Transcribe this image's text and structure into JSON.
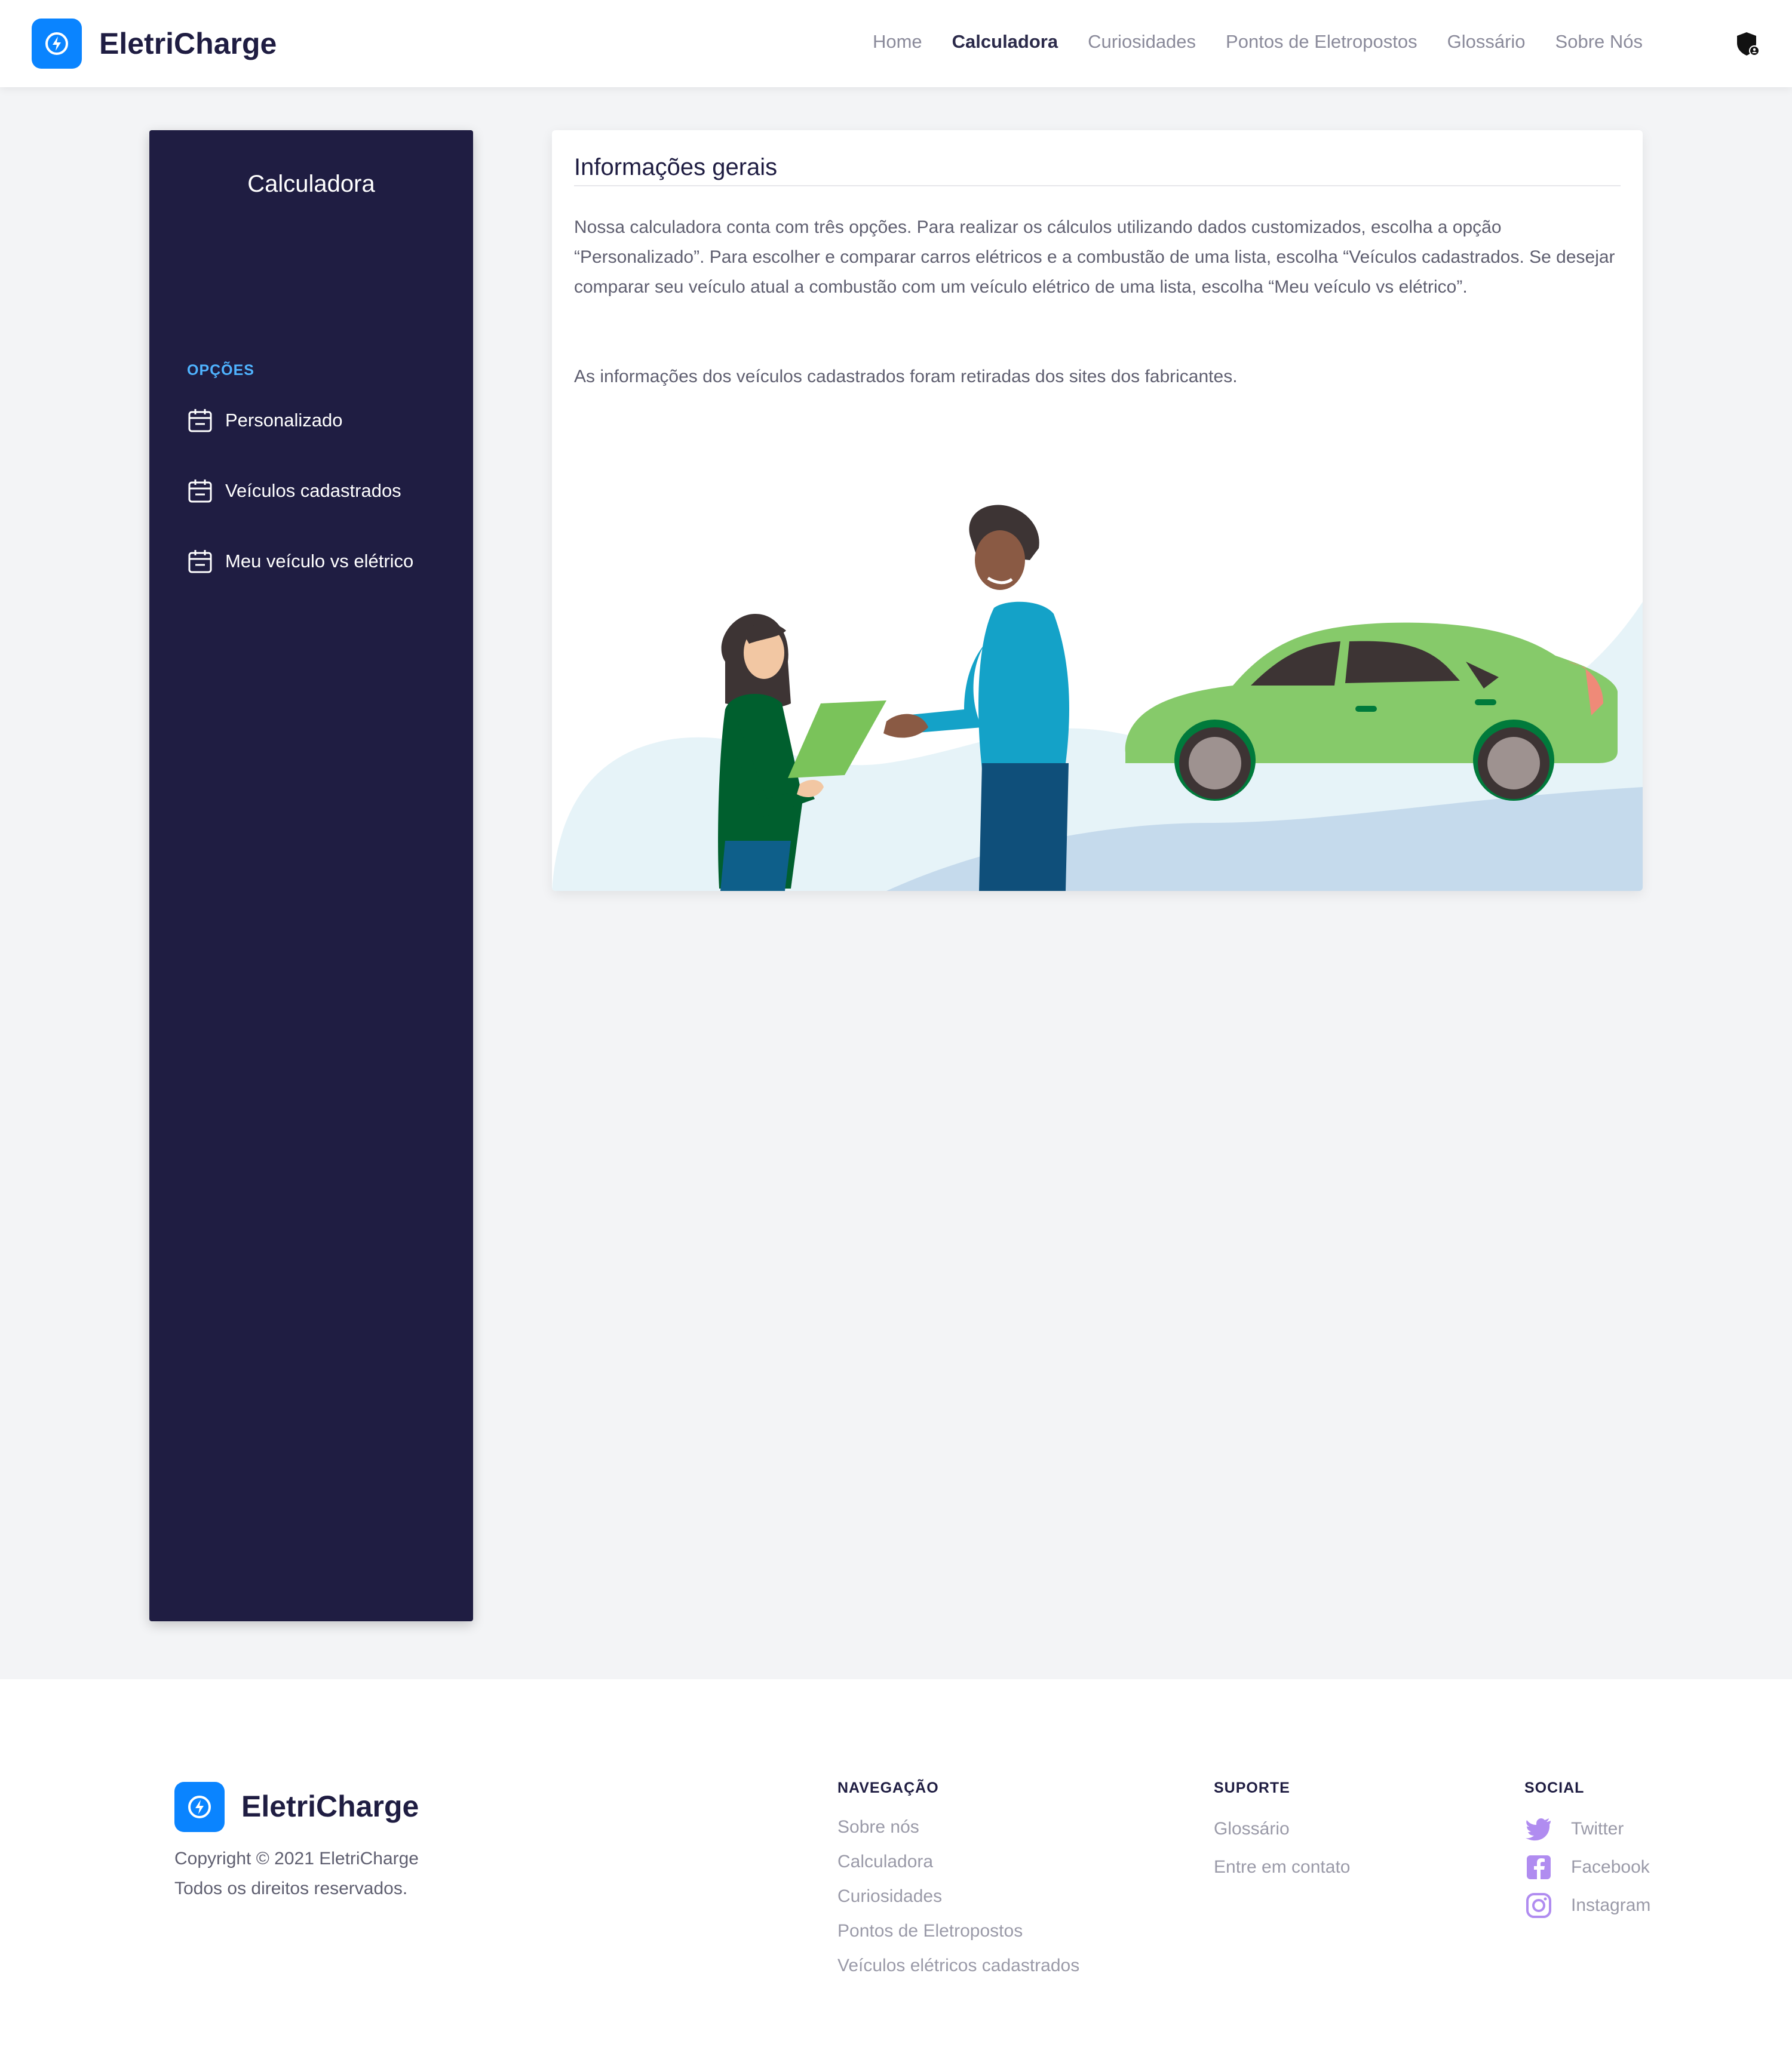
{
  "brand": {
    "name": "EletriCharge",
    "color": "#0a84ff",
    "icon": "bolt-circle-icon"
  },
  "nav": {
    "items": [
      "Home",
      "Calculadora",
      "Curiosidades",
      "Pontos de Eletropostos",
      "Glossário",
      "Sobre Nós"
    ],
    "active": "Calculadora",
    "account_icon": "shield-user-icon"
  },
  "sidebar": {
    "title": "Calculadora",
    "section_label": "OPÇÕES",
    "items": [
      {
        "label": "Personalizado",
        "icon": "calendar-icon"
      },
      {
        "label": "Veículos cadastrados",
        "icon": "calendar-icon"
      },
      {
        "label": "Meu veículo vs elétrico",
        "icon": "calendar-icon"
      }
    ]
  },
  "main": {
    "heading": "Informações gerais",
    "paragraph1": "Nossa calculadora conta com três opções. Para realizar os cálculos utilizando dados customizados, escolha a opção “Personalizado”. Para escolher e comparar carros elétricos e a combustão de uma lista, escolha “Veículos cadastrados. Se desejar comparar seu veículo atual a combustão com um veículo elétrico de uma lista, escolha “Meu veículo vs elétrico”.",
    "paragraph2": "As informações dos veículos cadastrados foram retiradas dos sites dos fabricantes."
  },
  "footer": {
    "brand": "EletriCharge",
    "copyright_line1": "Copyright © 2021 EletriCharge",
    "copyright_line2": "Todos os direitos reservados.",
    "navigation": {
      "title": "NAVEGAÇÃO",
      "links": [
        "Sobre nós",
        "Calculadora",
        "Curiosidades",
        "Pontos de Eletropostos",
        "Veículos elétricos cadastrados"
      ]
    },
    "support": {
      "title": "SUPORTE",
      "links": [
        "Glossário",
        "Entre em contato"
      ]
    },
    "social": {
      "title": "SOCIAL",
      "links": [
        {
          "label": "Twitter",
          "icon": "twitter-icon"
        },
        {
          "label": "Facebook",
          "icon": "facebook-icon"
        },
        {
          "label": "Instagram",
          "icon": "instagram-icon"
        }
      ],
      "icon_color": "#b08cf0"
    }
  }
}
